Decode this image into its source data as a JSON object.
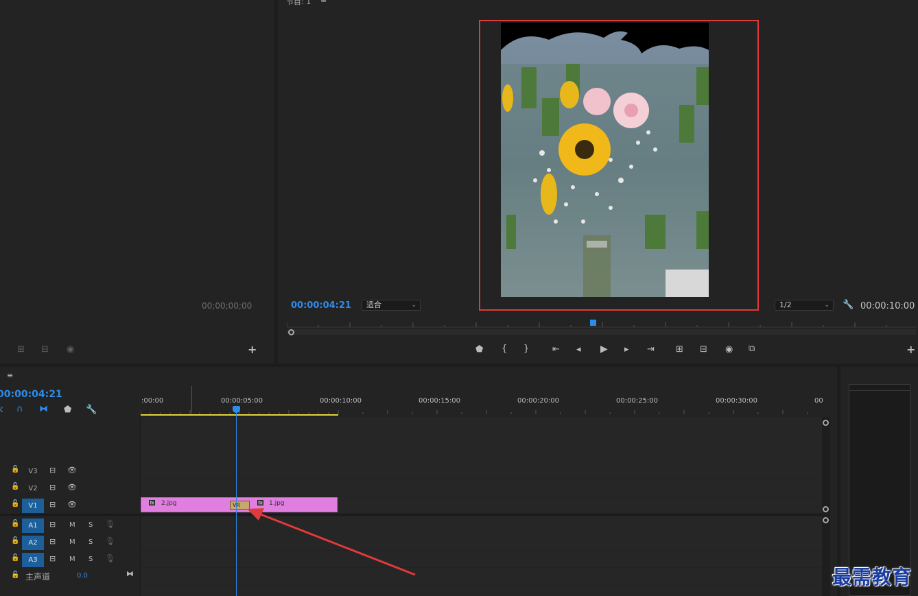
{
  "source": {
    "timecode": "00;00;00;00"
  },
  "program": {
    "title": "节目: 1",
    "current_time": "00:00:04:21",
    "fit_option": "适合",
    "resolution": "1/2",
    "duration": "00:00:10:00"
  },
  "timeline": {
    "current_time": "00:00:04:21",
    "ruler_labels": [
      ":00:00",
      "00:00:05:00",
      "00:00:10:00",
      "00:00:15:00",
      "00:00:20:00",
      "00:00:25:00",
      "00:00:30:00",
      "00"
    ],
    "video_tracks": [
      {
        "target": "V3",
        "selected": false
      },
      {
        "target": "V2",
        "selected": false
      },
      {
        "target": "V1",
        "selected": true
      }
    ],
    "audio_tracks": [
      {
        "target": "A1",
        "m": "M",
        "s": "S"
      },
      {
        "target": "A2",
        "m": "M",
        "s": "S"
      },
      {
        "target": "A3",
        "m": "M",
        "s": "S"
      }
    ],
    "master": {
      "label": "主声道",
      "value": "0.0"
    },
    "clips": [
      {
        "name": "2.jpg"
      },
      {
        "name": "1.jpg"
      }
    ],
    "transition_label": "VR"
  },
  "watermark": "最需教育",
  "colors": {
    "accent_blue": "#2d8ceb",
    "clip_pink": "#e07fe0",
    "highlight_red": "#e03a3a",
    "work_area_yellow": "#e6d23a"
  }
}
